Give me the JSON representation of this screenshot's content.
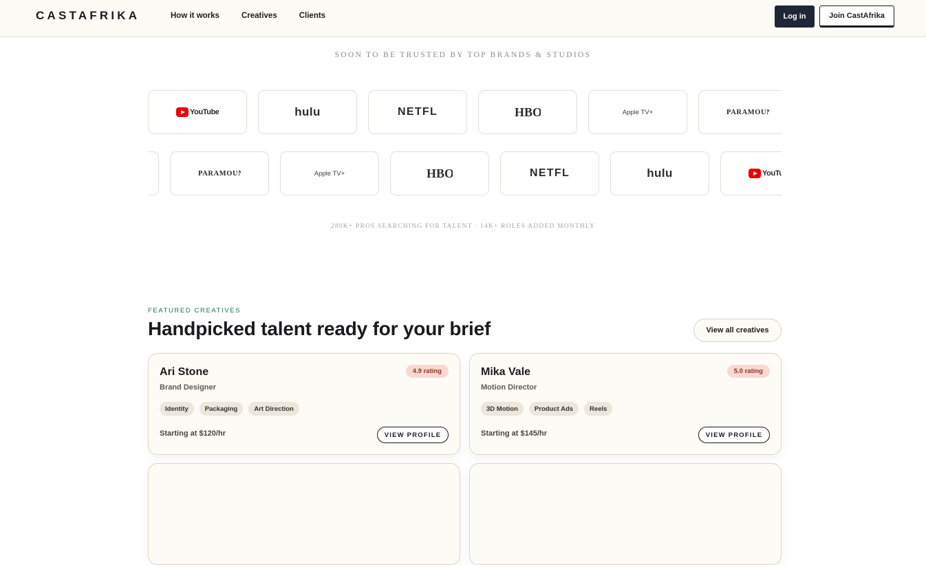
{
  "header": {
    "logo": "CASTAFRIKA",
    "nav": [
      "How it works",
      "Creatives",
      "Clients"
    ],
    "login_label": "Log in",
    "join_label": "Join CastAfrika"
  },
  "trusted": {
    "title": "SOON TO BE TRUSTED BY TOP BRANDS & STUDIOS",
    "row1": [
      {
        "brand": "Apple TV+",
        "kind": "appletv"
      },
      {
        "brand": "YouTube",
        "kind": "youtube"
      },
      {
        "brand": "hulu",
        "kind": "hulu"
      },
      {
        "brand": "NETFLIX",
        "kind": "netflix"
      },
      {
        "brand": "HBO",
        "kind": "hbo"
      },
      {
        "brand": "Apple TV+",
        "kind": "appletv"
      },
      {
        "brand": "PARAMOUNT",
        "kind": "paramount"
      }
    ],
    "row2": [
      {
        "brand": "YouTube",
        "kind": "youtube"
      },
      {
        "brand": "PARAMOUNT",
        "kind": "paramount"
      },
      {
        "brand": "Apple TV+",
        "kind": "appletv"
      },
      {
        "brand": "HBO",
        "kind": "hbo"
      },
      {
        "brand": "NETFLIX",
        "kind": "netflix"
      },
      {
        "brand": "hulu",
        "kind": "hulu"
      },
      {
        "brand": "YouTube",
        "kind": "youtube"
      }
    ],
    "stats": "280K+ PROS SEARCHING FOR TALENT · 14K+ ROLES ADDED MONTHLY"
  },
  "featured": {
    "eyebrow": "FEATURED CREATIVES",
    "title": "Handpicked talent ready for your brief",
    "view_all_label": "View all creatives",
    "cards": [
      {
        "name": "Ari Stone",
        "role": "Brand Designer",
        "rating": "4.9 rating",
        "tags": [
          "Identity",
          "Packaging",
          "Art Direction"
        ],
        "price": "Starting at $120/hr",
        "cta": "VIEW PROFILE"
      },
      {
        "name": "Mika Vale",
        "role": "Motion Director",
        "rating": "5.0 rating",
        "tags": [
          "3D Motion",
          "Product Ads",
          "Reels"
        ],
        "price": "Starting at $145/hr",
        "cta": "VIEW PROFILE"
      }
    ]
  },
  "colors": {
    "header_bg": "#fdfbf5",
    "login_bg": "#1f2637",
    "accent_green": "#1d6e58",
    "rating_bg": "#f8d9d2",
    "rating_text": "#8e3525",
    "card_bg": "#fdfbf5"
  },
  "icons": {
    "youtube": "youtube-play-icon"
  }
}
